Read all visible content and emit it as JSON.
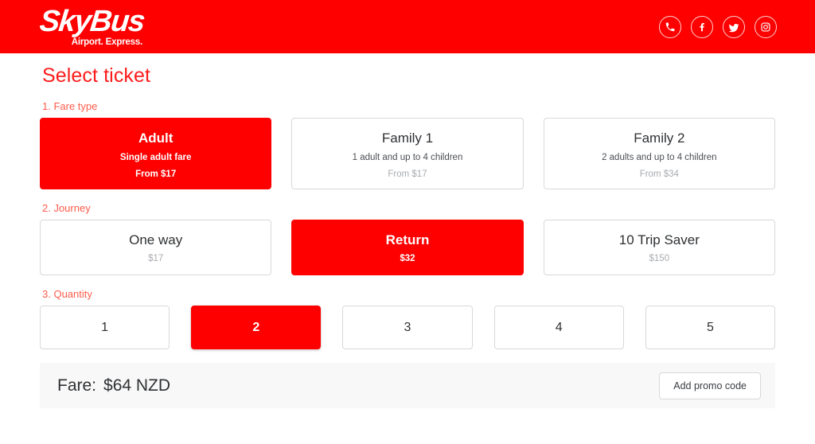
{
  "header": {
    "logo_main": "SkyBus",
    "logo_tagline": "Airport. Express.",
    "brand_red": "#FE0000",
    "social": [
      {
        "name": "phone-icon",
        "label": "Phone"
      },
      {
        "name": "facebook-icon",
        "label": "Facebook"
      },
      {
        "name": "twitter-icon",
        "label": "Twitter"
      },
      {
        "name": "instagram-icon",
        "label": "Instagram"
      }
    ]
  },
  "page": {
    "title": "Select ticket",
    "title_color": "#FE1C1C",
    "step_label_color": "#FF5B4B"
  },
  "steps": {
    "fare_type": {
      "label": "1. Fare type",
      "options": [
        {
          "title": "Adult",
          "sub": "Single adult fare",
          "price": "From $17",
          "selected": true
        },
        {
          "title": "Family 1",
          "sub": "1 adult and up to 4 children",
          "price": "From $17",
          "selected": false
        },
        {
          "title": "Family 2",
          "sub": "2 adults and up to 4 children",
          "price": "From $34",
          "selected": false
        }
      ]
    },
    "journey": {
      "label": "2. Journey",
      "options": [
        {
          "title": "One way",
          "price": "$17",
          "selected": false
        },
        {
          "title": "Return",
          "price": "$32",
          "selected": true
        },
        {
          "title": "10 Trip Saver",
          "price": "$150",
          "selected": false
        }
      ]
    },
    "quantity": {
      "label": "3. Quantity",
      "options": [
        {
          "value": "1",
          "selected": false
        },
        {
          "value": "2",
          "selected": true
        },
        {
          "value": "3",
          "selected": false
        },
        {
          "value": "4",
          "selected": false
        },
        {
          "value": "5",
          "selected": false
        }
      ]
    }
  },
  "summary": {
    "fare_label": "Fare:",
    "fare_amount": "$64 NZD",
    "promo_button": "Add promo code"
  }
}
